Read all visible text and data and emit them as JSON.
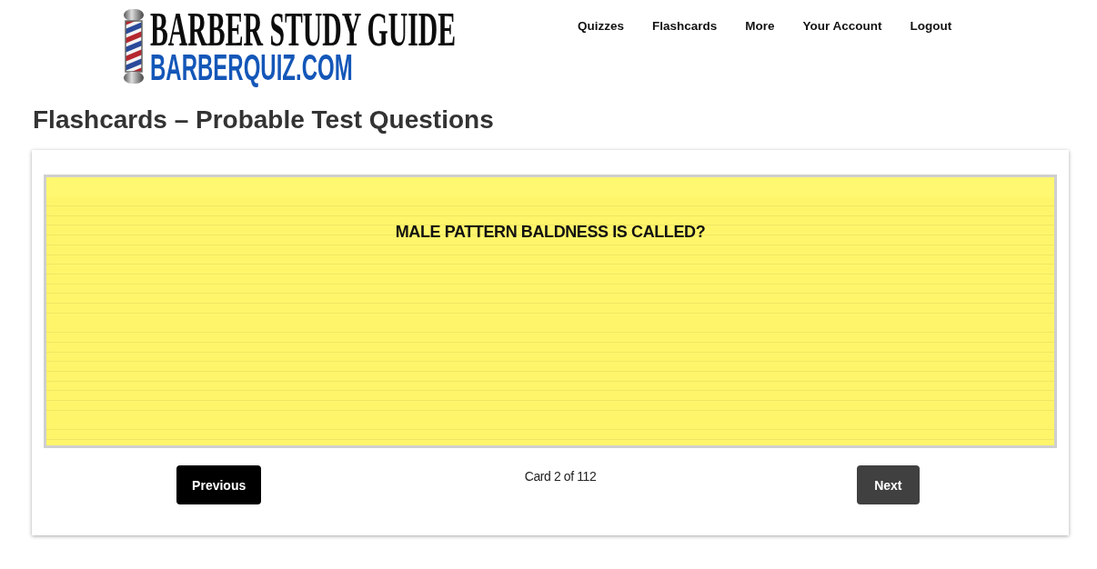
{
  "header": {
    "logo": {
      "title": "BARBER STUDY GUIDE",
      "domain": "BARBERQUIZ.COM"
    },
    "nav": [
      {
        "label": "Quizzes"
      },
      {
        "label": "Flashcards"
      },
      {
        "label": "More"
      },
      {
        "label": "Your Account"
      },
      {
        "label": "Logout"
      }
    ]
  },
  "page_title": "Flashcards – Probable Test Questions",
  "flashcard": {
    "question": "MALE PATTERN BALDNESS IS CALLED?"
  },
  "controls": {
    "previous": {
      "label": "Previous",
      "active": true
    },
    "counter": "Card 2 of 112",
    "next": {
      "label": "Next",
      "active": false
    }
  }
}
